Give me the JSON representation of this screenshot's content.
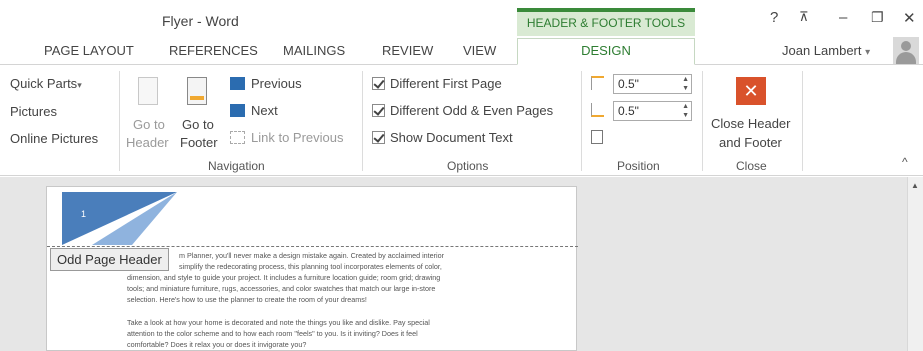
{
  "titlebar": {
    "title": "Flyer - Word",
    "context_tools": "HEADER & FOOTER TOOLS",
    "help": "?",
    "ribbon_display": "⊼",
    "minimize": "–",
    "restore": "❐",
    "close": "✕"
  },
  "tabs": {
    "items": [
      "PAGE LAYOUT",
      "REFERENCES",
      "MAILINGS",
      "REVIEW",
      "VIEW"
    ],
    "active": "DESIGN",
    "user": "Joan Lambert",
    "user_caret": "▾"
  },
  "ribbon": {
    "insert": {
      "quick_parts": "Quick Parts",
      "quick_parts_caret": "▾",
      "pictures": "Pictures",
      "online_pictures": "Online Pictures"
    },
    "navigation": {
      "go_to_header_1": "Go to",
      "go_to_header_2": "Header",
      "go_to_footer_1": "Go to",
      "go_to_footer_2": "Footer",
      "previous": "Previous",
      "next": "Next",
      "link_to_previous": "Link to Previous",
      "label": "Navigation"
    },
    "options": {
      "different_first_page": "Different First Page",
      "different_odd_even": "Different Odd & Even Pages",
      "show_document_text": "Show Document Text",
      "label": "Options"
    },
    "position": {
      "header_from_top": "0.5\"",
      "footer_from_bottom": "0.5\"",
      "label": "Position"
    },
    "close": {
      "line1": "Close Header",
      "line2": "and Footer",
      "label": "Close"
    },
    "collapse": "^"
  },
  "document": {
    "page_number": "1",
    "header_tag": "Odd Page Header",
    "para1": [
      "m Planner, you'll never make a design mistake again. Created by acclaimed interior",
      "simplify the redecorating process, this planning tool incorporates elements of color,",
      "dimension, and style to guide your project. It includes a furniture location guide; room grid; drawing",
      "tools; and miniature furniture, rugs, accessories, and color swatches that match our large in-store",
      "selection. Here's how to use the planner to create the room of your dreams!"
    ],
    "para2": [
      "Take a look at how your home is decorated and note the things you like and dislike. Pay special",
      "attention to the color scheme and to how each room \"feels\" to you. Is it inviting? Does it feel",
      "comfortable? Does it relax you or does it invigorate you?"
    ],
    "scroll_up": "▲"
  },
  "colors": {
    "accent": "#2e7d32",
    "close_button": "#d9522b",
    "header_shape": "#4a7ebb"
  }
}
